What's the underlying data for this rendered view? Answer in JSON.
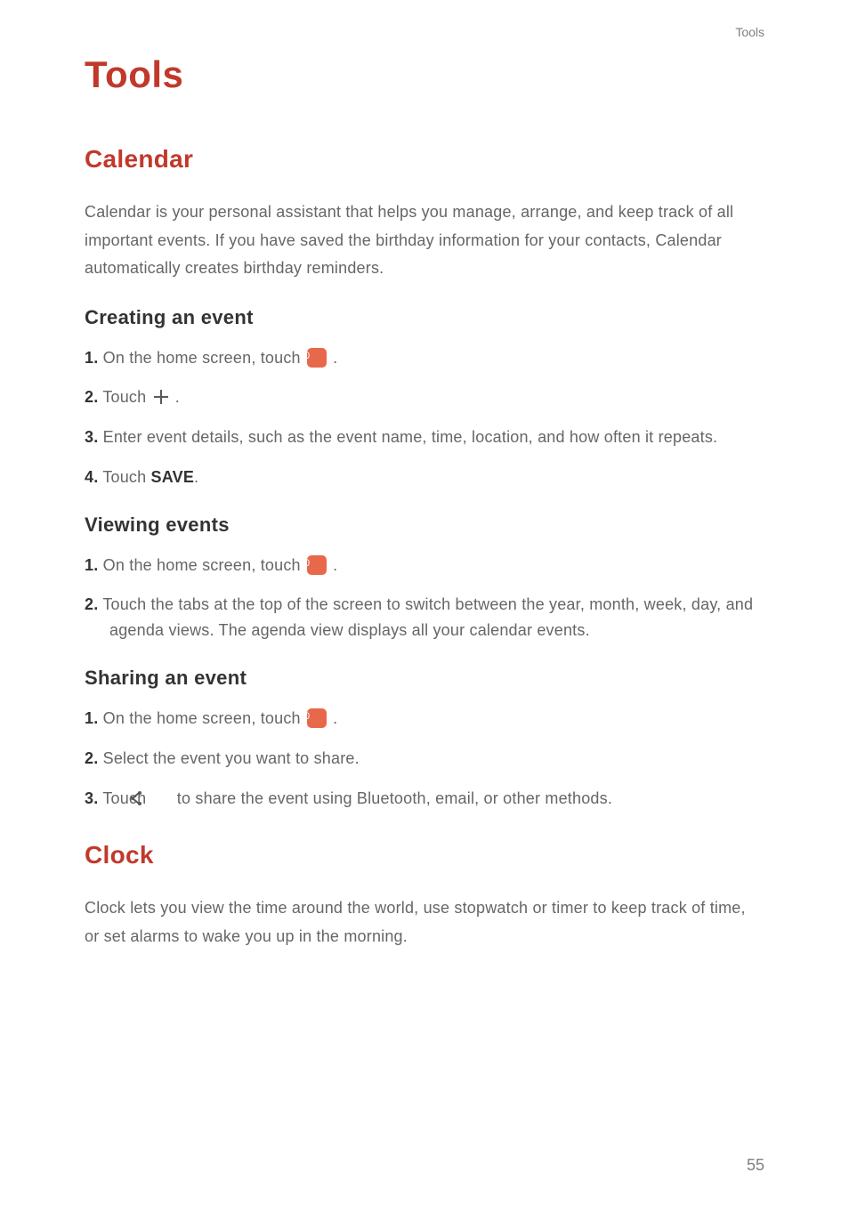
{
  "runningHeader": "Tools",
  "pageNumber": "55",
  "chapterTitle": "Tools",
  "sections": {
    "calendar": {
      "title": "Calendar",
      "intro": "Calendar is your personal assistant that helps you manage, arrange, and keep track of all important events. If you have saved the birthday information for your contacts, Calendar automatically creates birthday reminders.",
      "sub": {
        "creating": {
          "title": "Creating an event",
          "steps": {
            "s1_num": "1.",
            "s1_a": "On the home screen, touch ",
            "s1_b": ".",
            "s2_num": "2.",
            "s2_a": "Touch ",
            "s2_b": ".",
            "s3_num": "3.",
            "s3_a": "Enter event details, such as the event name, time, location, and how often it repeats.",
            "s4_num": "4.",
            "s4_a": "Touch ",
            "s4_ui": "SAVE",
            "s4_b": "."
          }
        },
        "viewing": {
          "title": "Viewing events",
          "steps": {
            "s1_num": "1.",
            "s1_a": "On the home screen, touch ",
            "s1_b": ".",
            "s2_num": "2.",
            "s2_a": "Touch the tabs at the top of the screen to switch between the year, month, week, day, and agenda views. The agenda view displays all your calendar events."
          }
        },
        "sharing": {
          "title": "Sharing an event",
          "steps": {
            "s1_num": "1.",
            "s1_a": "On the home screen, touch ",
            "s1_b": ".",
            "s2_num": "2.",
            "s2_a": "Select the event you want to share.",
            "s3_num": "3.",
            "s3_a": "Touch ",
            "s3_b": " to share the event using Bluetooth, email, or other methods."
          }
        }
      }
    },
    "clock": {
      "title": "Clock",
      "intro": "Clock lets you view the time around the world, use stopwatch or timer to keep track of time, or set alarms to wake you up in the morning."
    }
  }
}
